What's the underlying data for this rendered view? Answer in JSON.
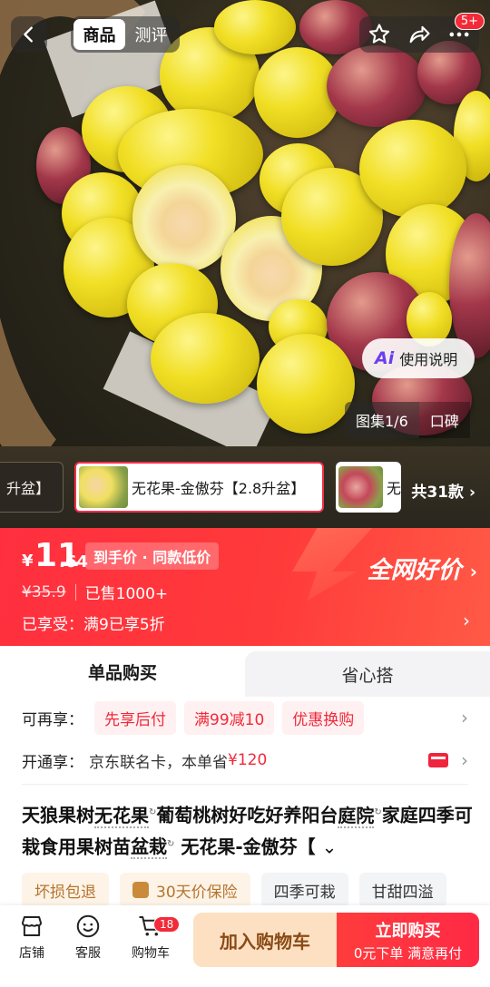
{
  "header": {
    "tabs": [
      {
        "label": "商品"
      },
      {
        "label": "测评"
      }
    ],
    "notification_badge": "5+"
  },
  "hero": {
    "ai_pill_label": "使用说明",
    "ai_icon_text": "Ai",
    "gallery_label": "图集1/6",
    "reviews_label": "口碑"
  },
  "variants": {
    "items": [
      {
        "label": "升盆】"
      },
      {
        "label": "无花果-金傲芬【2.8升盆】"
      },
      {
        "label": "无"
      }
    ],
    "total_label": "共31款"
  },
  "price": {
    "currency": "¥",
    "integer": "11",
    "decimal": ".64",
    "tag": "到手价 · 同款低价",
    "original": "¥35.9",
    "sold": "已售1000+",
    "promo": "已享受：满9已享5折",
    "best_price_label": "全网好价",
    "accent_color": "#ff2f3f"
  },
  "purchase_tabs": [
    {
      "label": "单品购买"
    },
    {
      "label": "省心搭"
    }
  ],
  "services": {
    "label": "可再享：",
    "chips": [
      {
        "label": "先享后付"
      },
      {
        "label": "满99减10"
      },
      {
        "label": "优惠换购"
      }
    ]
  },
  "card": {
    "label": "开通享：",
    "text": "京东联名卡，本单省",
    "amount": "¥120"
  },
  "product": {
    "title_parts": [
      "天狼果树",
      "无花果",
      "葡萄桃树好吃好养阳台",
      "庭院",
      "家庭四季可栽食用果树苗",
      "盆栽",
      "无花果-金傲芬【"
    ]
  },
  "features": [
    {
      "label": "坏损包退"
    },
    {
      "label": "30天价保险"
    },
    {
      "label": "四季可栽"
    },
    {
      "label": "甘甜四溢"
    }
  ],
  "bottom_bar": {
    "shop_label": "店铺",
    "service_label": "客服",
    "cart_label": "购物车",
    "cart_count": "18",
    "add_to_cart": "加入购物车",
    "buy_now": "立即购买",
    "buy_now_sub": "0元下单 满意再付"
  }
}
